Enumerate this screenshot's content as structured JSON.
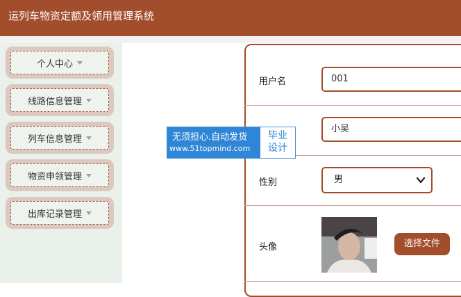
{
  "app": {
    "title": "运列车物资定额及领用管理系统"
  },
  "sidebar": {
    "items": [
      {
        "label": "个人中心"
      },
      {
        "label": "线路信息管理"
      },
      {
        "label": "列车信息管理"
      },
      {
        "label": "物资申领管理"
      },
      {
        "label": "出库记录管理"
      }
    ]
  },
  "form": {
    "username": {
      "label": "用户名",
      "value": "001"
    },
    "name": {
      "value": "小吴"
    },
    "gender": {
      "label": "性别",
      "value": "男"
    },
    "avatar": {
      "label": "头像",
      "button": "选择文件"
    }
  },
  "watermark": {
    "line1": "无须担心.自动发货",
    "line2": "www.51topmind.com",
    "badge_line1": "毕业",
    "badge_line2": "设计"
  },
  "colors": {
    "brand": "#a24d2c",
    "watermark": "#2f86d6"
  }
}
